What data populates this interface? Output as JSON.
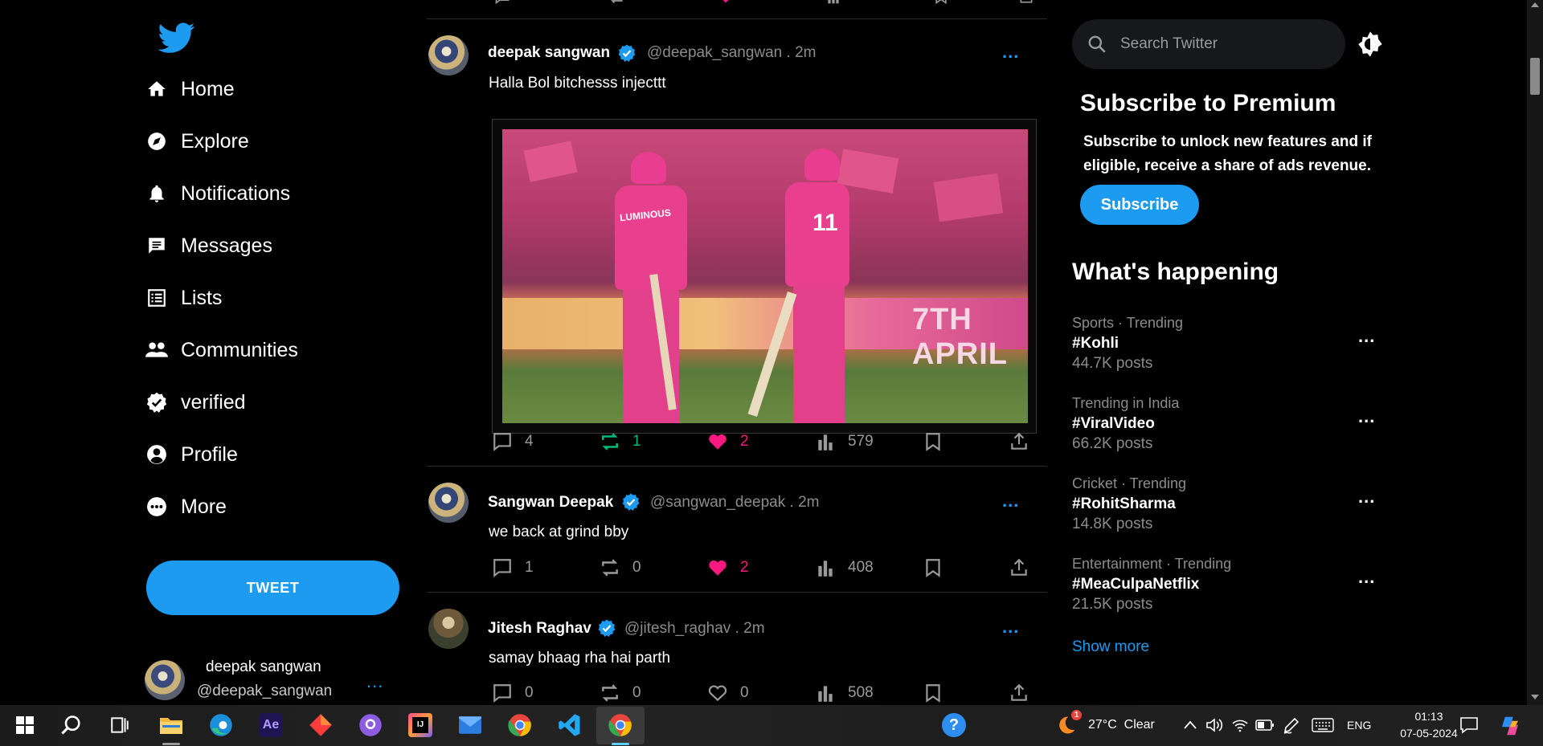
{
  "sidebar": {
    "nav": [
      {
        "label": "Home",
        "icon": "home-icon"
      },
      {
        "label": "Explore",
        "icon": "explore-icon"
      },
      {
        "label": "Notifications",
        "icon": "bell-icon"
      },
      {
        "label": "Messages",
        "icon": "message-icon"
      },
      {
        "label": "Lists",
        "icon": "list-icon"
      },
      {
        "label": "Communities",
        "icon": "people-icon"
      },
      {
        "label": "verified",
        "icon": "verified-badge-icon"
      },
      {
        "label": "Profile",
        "icon": "person-icon"
      },
      {
        "label": "More",
        "icon": "more-circle-icon"
      }
    ],
    "tweet_button": "TWEET",
    "account": {
      "name": "deepak sangwan",
      "handle": "@deepak_sangwan",
      "more": "..."
    }
  },
  "feed": {
    "tweets": [
      {
        "name": "deepak sangwan",
        "handle": "@deepak_sangwan . 2m",
        "text": "Halla Bol bitchesss injecttt",
        "has_image": true,
        "image_text": {
          "player1_shirt": "LUMINOUS",
          "player2_number": "11",
          "board": "7TH APRIL"
        },
        "replies": "4",
        "retweets": "1",
        "likes": "2",
        "views": "579",
        "liked": true,
        "retweeted": true
      },
      {
        "name": "Sangwan Deepak",
        "handle": "@sangwan_deepak . 2m",
        "text": "we back at grind bby",
        "has_image": false,
        "replies": "1",
        "retweets": "0",
        "likes": "2",
        "views": "408",
        "liked": true,
        "retweeted": false
      },
      {
        "name": "Jitesh Raghav",
        "handle": "@jitesh_raghav . 2m",
        "text": "samay bhaag rha hai parth",
        "has_image": false,
        "replies": "0",
        "retweets": "0",
        "likes": "0",
        "views": "508",
        "liked": false,
        "retweeted": false
      }
    ],
    "more": "..."
  },
  "right": {
    "search_placeholder": "Search Twitter",
    "premium": {
      "title": "Subscribe to Premium",
      "description": "Subscribe to unlock new features and if eligible, receive a share of ads revenue.",
      "button": "Subscribe"
    },
    "whats_happening": "What's happening",
    "trends": [
      {
        "category": "Sports · Trending",
        "tag": "#Kohli",
        "posts": "44.7K posts"
      },
      {
        "category": "Trending in India",
        "tag": "#ViralVideo",
        "posts": "66.2K posts"
      },
      {
        "category": "Cricket · Trending",
        "tag": "#RohitSharma",
        "posts": "14.8K posts"
      },
      {
        "category": "Entertainment · Trending",
        "tag": "#MeaCulpaNetflix",
        "posts": "21.5K posts"
      }
    ],
    "trend_more": "...",
    "show_more": "Show more"
  },
  "taskbar": {
    "apps": [
      "start-icon",
      "search-icon",
      "task-view-icon",
      "file-explorer-icon",
      "edge-icon",
      "after-effects-icon",
      "app-red-icon",
      "github-icon",
      "intellij-icon",
      "mail-icon",
      "chrome-icon",
      "vscode-icon",
      "chrome-active-icon"
    ],
    "ae_label": "Ae",
    "ij_label": "IJ",
    "help_label": "?",
    "weather": {
      "badge": "1",
      "text": "27°C  Clear"
    },
    "lang": "ENG",
    "time": "01:13",
    "date": "07-05-2024"
  },
  "colors": {
    "accent": "#1d9bf0",
    "like": "#f91880",
    "retweet": "#00ba7c",
    "background": "#000000"
  }
}
